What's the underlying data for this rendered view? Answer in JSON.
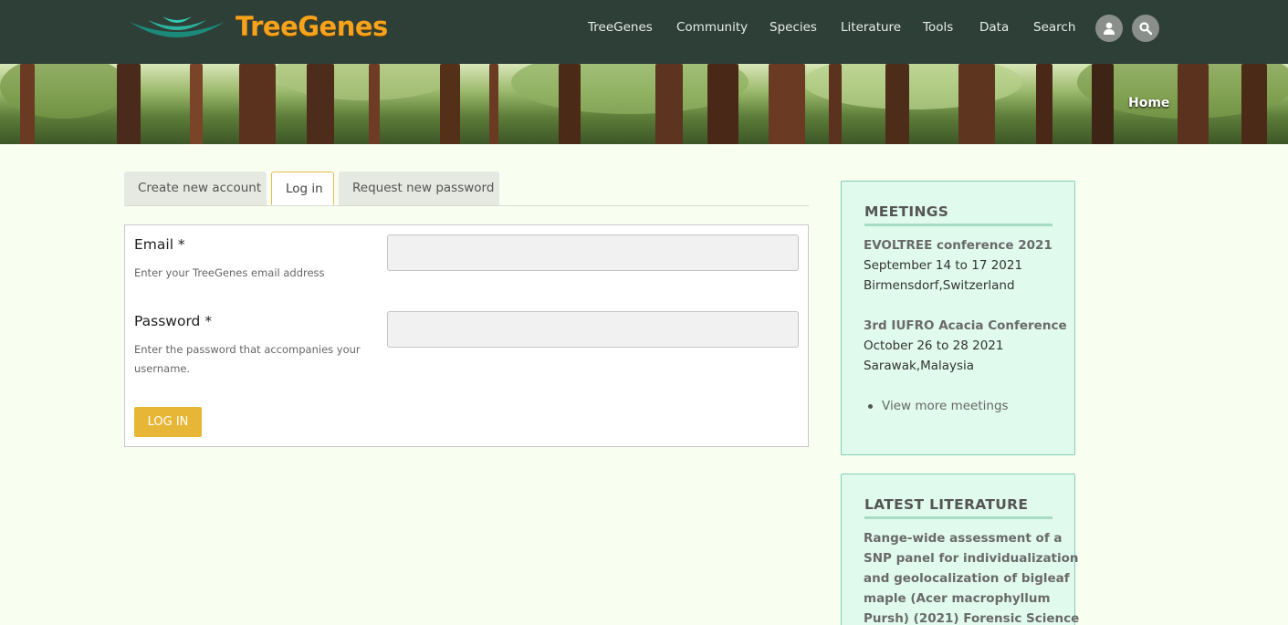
{
  "brand": {
    "name": "TreeGenes"
  },
  "nav": {
    "items": [
      "TreeGenes",
      "Community",
      "Species",
      "Literature",
      "Tools",
      "Data",
      "Search"
    ]
  },
  "banner": {
    "breadcrumb": "Home"
  },
  "tabs": [
    {
      "label": "Create new account",
      "active": false
    },
    {
      "label": "Log in",
      "active": true
    },
    {
      "label": "Request new password",
      "active": false
    }
  ],
  "form": {
    "email": {
      "label": "Email *",
      "description": "Enter your TreeGenes email address",
      "value": ""
    },
    "password": {
      "label": "Password *",
      "description_line1": "Enter the password that accompanies your",
      "description_line2": "username.",
      "value": ""
    },
    "submit_label": "LOG IN"
  },
  "meetings": {
    "heading": "MEETINGS",
    "items": [
      {
        "title": "EVOLTREE conference 2021",
        "dates": "September 14 to 17 2021",
        "location": "Birmensdorf,Switzerland"
      },
      {
        "title": "3rd IUFRO Acacia Conference",
        "dates": "October 26 to 28 2021",
        "location": "Sarawak,Malaysia"
      }
    ],
    "more_label": "View more meetings"
  },
  "literature": {
    "heading": "LATEST LITERATURE",
    "lines": [
      "Range-wide assessment of a",
      "SNP panel for individualization",
      "and geolocalization of bigleaf",
      "maple (Acer macrophyllum",
      "Pursh) (2021) Forensic Science"
    ]
  },
  "colors": {
    "header_bg": "#2e3f38",
    "brand_orange": "#f6a21c",
    "button_gold": "#e8b636",
    "panel_bg": "#e0faee",
    "page_bg": "#f8fff0"
  }
}
